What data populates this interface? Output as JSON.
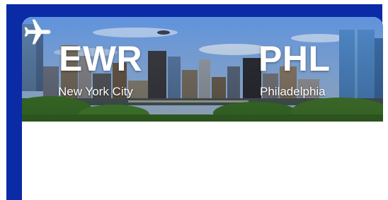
{
  "route": {
    "origin": {
      "code": "EWR",
      "city": "New York City"
    },
    "destination": {
      "code": "PHL",
      "city": "Philadelphia"
    },
    "icon": "airplane-icon"
  },
  "colors": {
    "frame": "#0a2aa6",
    "sky": "#6f9fe0",
    "text": "#ffffff"
  }
}
